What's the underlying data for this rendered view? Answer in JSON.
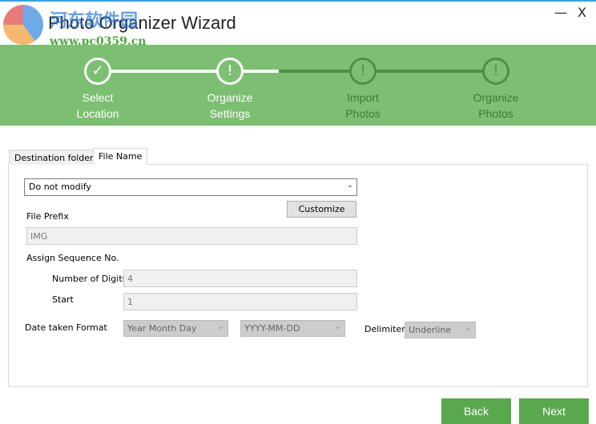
{
  "window": {
    "title": "Photo Organizer Wizard",
    "minimize": "—",
    "close": "X"
  },
  "watermark": {
    "line1": "河东软件园",
    "line2": "www.pc0359.cn"
  },
  "steps": [
    {
      "label1": "Select",
      "label2": "Location",
      "status": "done",
      "icon": "✓"
    },
    {
      "label1": "Organize",
      "label2": "Settings",
      "status": "current",
      "icon": "!"
    },
    {
      "label1": "Import",
      "label2": "Photos",
      "status": "pending",
      "icon": "!"
    },
    {
      "label1": "Organize",
      "label2": "Photos",
      "status": "pending",
      "icon": "!"
    }
  ],
  "tabs": [
    {
      "label": "Destination folder"
    },
    {
      "label": "File Name",
      "active": true
    }
  ],
  "form": {
    "rename_mode": "Do not modify",
    "customize": "Customize",
    "file_prefix_label": "File Prefix",
    "file_prefix": "IMG",
    "sequence_label": "Assign Sequence No.",
    "digits_label": "Number of Digits",
    "digits": "4",
    "start_label": "Start",
    "start": "1",
    "date_label": "Date taken Format",
    "date_order": "Year Month Day",
    "date_format": "YYYY-MM-DD",
    "delimiter_label": "Delimiter",
    "delimiter": "Underline"
  },
  "buttons": {
    "back": "Back",
    "next": "Next"
  },
  "colors": {
    "band": "#7cbf72",
    "pending": "#4e8f45",
    "button": "#5aa84e"
  }
}
